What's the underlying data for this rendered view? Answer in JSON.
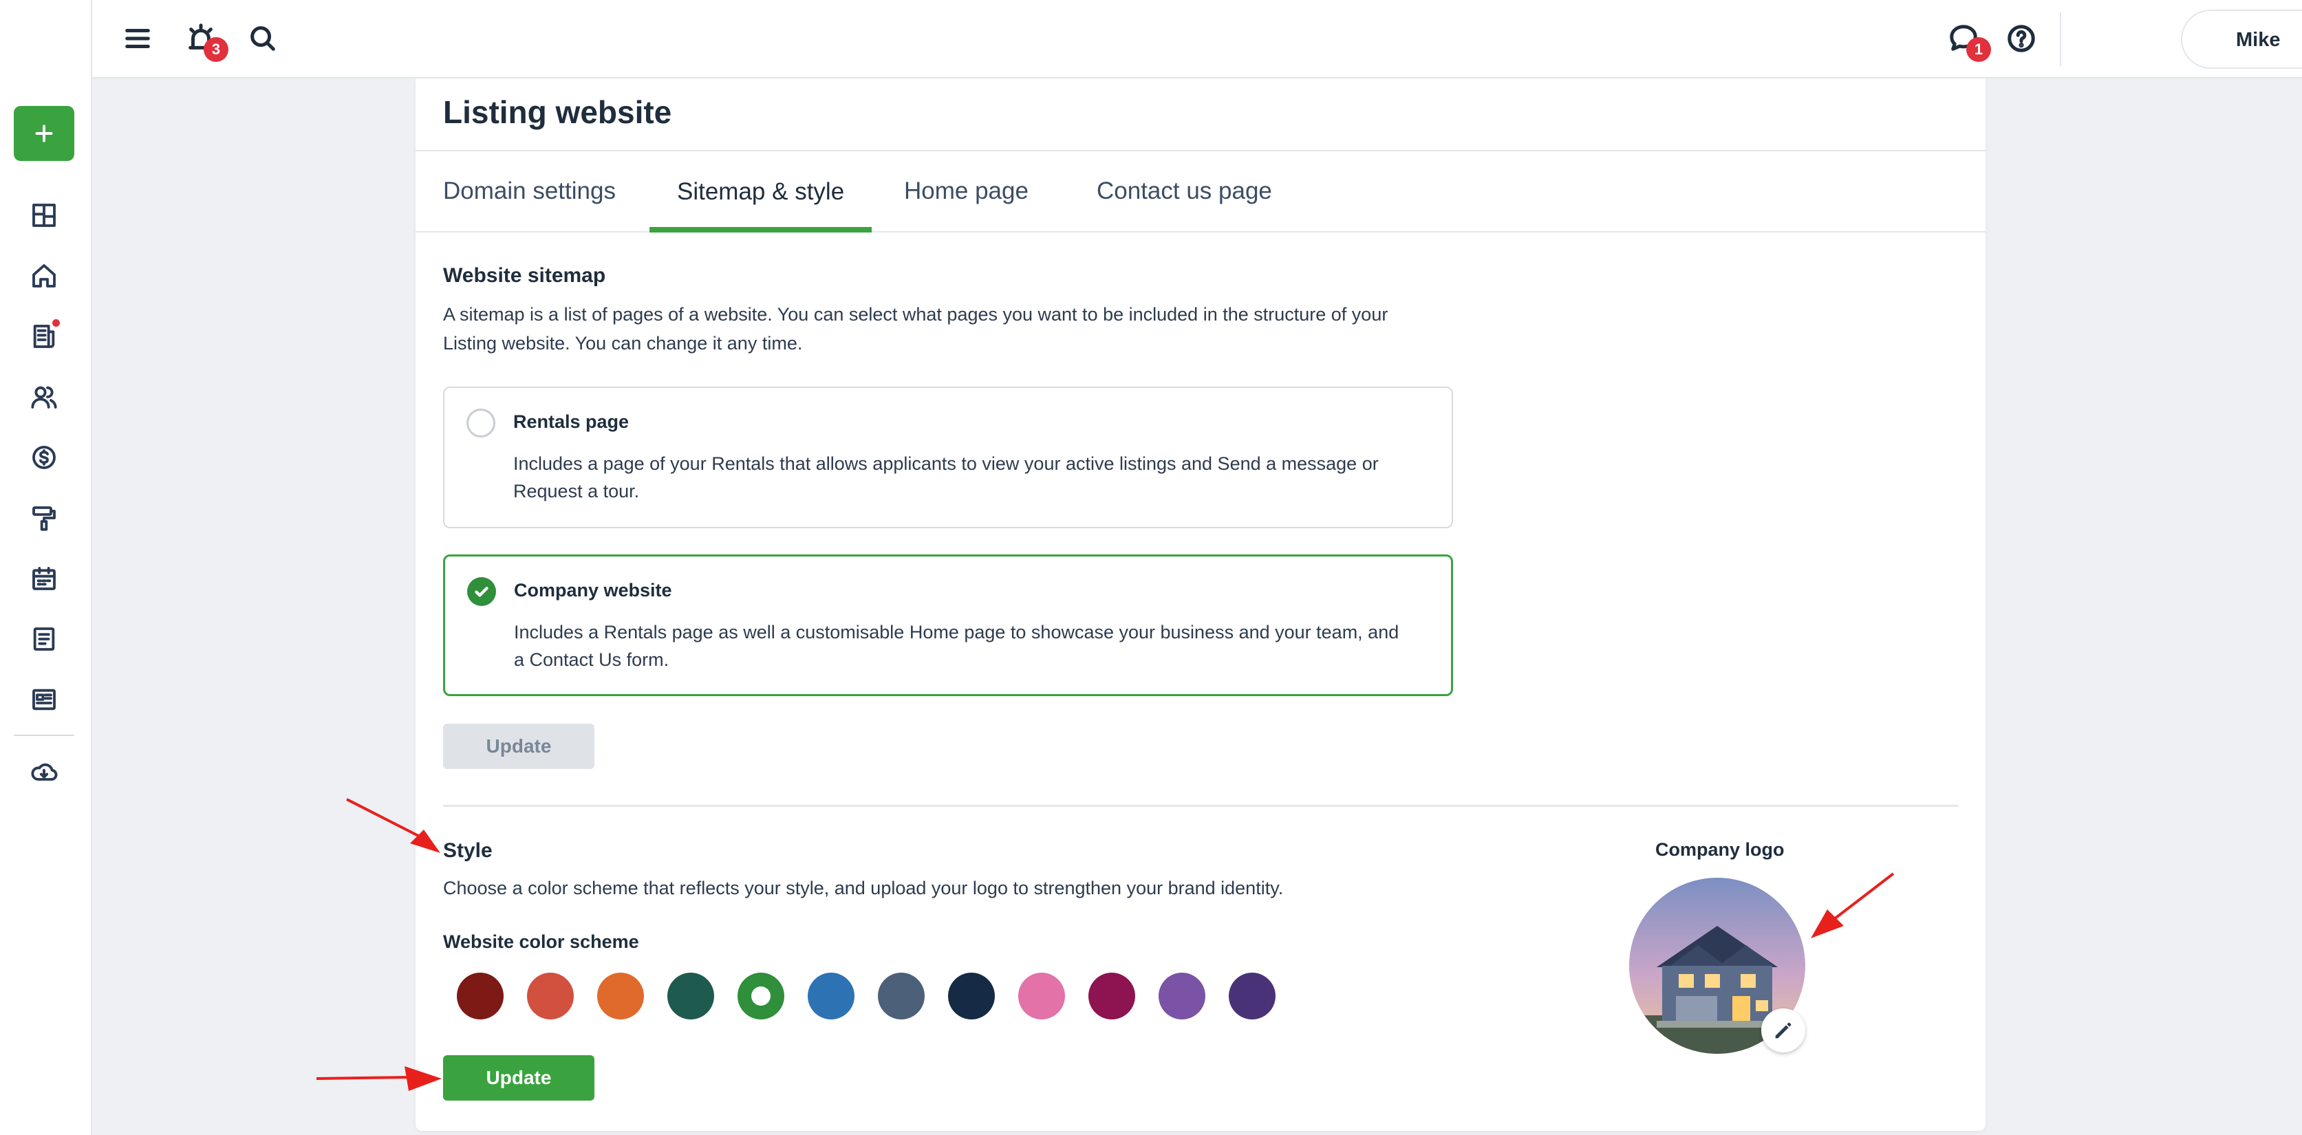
{
  "topbar": {
    "alerts_count": "3",
    "messages_count": "1",
    "user_name": "Mike"
  },
  "page": {
    "title": "Listing website",
    "tabs": [
      {
        "label": "Domain settings",
        "active": false
      },
      {
        "label": "Sitemap & style",
        "active": true
      },
      {
        "label": "Home page",
        "active": false
      },
      {
        "label": "Contact us page",
        "active": false
      }
    ]
  },
  "sitemap": {
    "title": "Website sitemap",
    "description_line1": "A sitemap is a list of pages of a website. You can select what pages you want to be included in the structure of your",
    "description_line2": "Listing website. You can change it any time.",
    "options": [
      {
        "title": "Rentals page",
        "description_line1": "Includes a page of your Rentals that allows applicants to view your active listings and Send a message or",
        "description_line2": "Request a tour.",
        "selected": false
      },
      {
        "title": "Company website",
        "description_line1": "Includes a Rentals page as well a customisable Home page to showcase your business and your team, and",
        "description_line2": "a Contact Us form.",
        "selected": true
      }
    ],
    "update_label": "Update"
  },
  "style": {
    "title": "Style",
    "description": "Choose a color scheme that reflects your style, and upload your logo to strengthen your brand identity.",
    "color_scheme_label": "Website color scheme",
    "colors": [
      "#7d1a15",
      "#d1503e",
      "#e06a2b",
      "#1f5a4e",
      "#2f8f3a",
      "#2d73b4",
      "#4c6079",
      "#152a45",
      "#e272a8",
      "#8d1450",
      "#7a53a6",
      "#4a3278"
    ],
    "selected_color_index": 4,
    "update_label": "Update",
    "logo_label": "Company logo"
  },
  "colors": {
    "accent": "#3aa33f",
    "badge": "#e0313d",
    "annotation_arrow": "#e8201c"
  }
}
